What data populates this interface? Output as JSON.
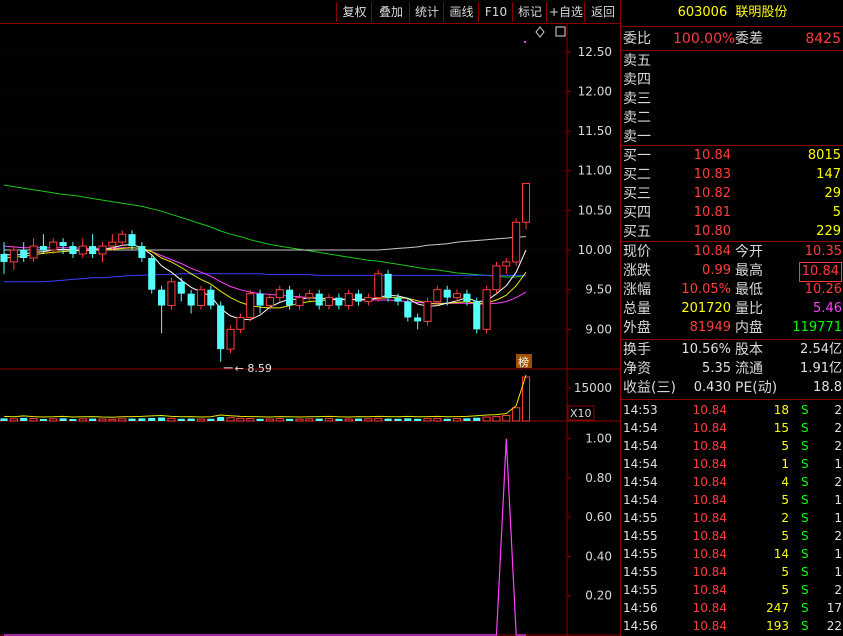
{
  "toolbar": [
    "复权",
    "叠加",
    "统计",
    "画线",
    "F10",
    "标记",
    "+自选",
    "返回"
  ],
  "stock": {
    "code": "603006",
    "name": "联明股份"
  },
  "price_axis": [
    "12.50",
    "12.00",
    "11.50",
    "11.00",
    "10.50",
    "10.00",
    "9.50",
    "9.00"
  ],
  "vol_axis": {
    "label": "15000",
    "mult": "X10"
  },
  "ind_axis": [
    "1.00",
    "0.80",
    "0.60",
    "0.40",
    "0.20"
  ],
  "low_marker": "8.59",
  "bang_label": "榜",
  "order_ratio": {
    "label1": "委比",
    "value1": "100.00%",
    "label2": "委差",
    "value2": "8425"
  },
  "sells": [
    {
      "label": "卖五"
    },
    {
      "label": "卖四"
    },
    {
      "label": "卖三"
    },
    {
      "label": "卖二"
    },
    {
      "label": "卖一"
    }
  ],
  "buys": [
    {
      "label": "买一",
      "price": "10.84",
      "vol": "8015"
    },
    {
      "label": "买二",
      "price": "10.83",
      "vol": "147"
    },
    {
      "label": "买三",
      "price": "10.82",
      "vol": "29"
    },
    {
      "label": "买四",
      "price": "10.81",
      "vol": "5"
    },
    {
      "label": "买五",
      "price": "10.80",
      "vol": "229"
    }
  ],
  "quote": [
    {
      "l1": "现价",
      "v1": "10.84",
      "c1": "red",
      "l2": "今开",
      "v2": "10.35",
      "c2": "red"
    },
    {
      "l1": "涨跌",
      "v1": "0.99",
      "c1": "red",
      "l2": "最高",
      "v2": "10.84",
      "c2": "red"
    },
    {
      "l1": "涨幅",
      "v1": "10.05%",
      "c1": "red",
      "l2": "最低",
      "v2": "10.26",
      "c2": "red"
    },
    {
      "l1": "总量",
      "v1": "201720",
      "c1": "yel",
      "l2": "量比",
      "v2": "5.46",
      "c2": "mag"
    },
    {
      "l1": "外盘",
      "v1": "81949",
      "c1": "red",
      "l2": "内盘",
      "v2": "119771",
      "c2": "grn"
    }
  ],
  "fund": [
    {
      "l1": "换手",
      "v1": "10.56%",
      "l2": "股本",
      "v2": "2.54亿"
    },
    {
      "l1": "净资",
      "v1": "5.35",
      "l2": "流通",
      "v2": "1.91亿"
    },
    {
      "l1": "收益(三)",
      "v1": "0.430",
      "l2": "PE(动)",
      "v2": "18.8"
    }
  ],
  "trades": [
    {
      "t": "14:53",
      "p": "10.84",
      "v": "18",
      "s": "S",
      "n": "2"
    },
    {
      "t": "14:54",
      "p": "10.84",
      "v": "15",
      "s": "S",
      "n": "2"
    },
    {
      "t": "14:54",
      "p": "10.84",
      "v": "5",
      "s": "S",
      "n": "2"
    },
    {
      "t": "14:54",
      "p": "10.84",
      "v": "1",
      "s": "S",
      "n": "1"
    },
    {
      "t": "14:54",
      "p": "10.84",
      "v": "4",
      "s": "S",
      "n": "2"
    },
    {
      "t": "14:54",
      "p": "10.84",
      "v": "5",
      "s": "S",
      "n": "1"
    },
    {
      "t": "14:55",
      "p": "10.84",
      "v": "2",
      "s": "S",
      "n": "1"
    },
    {
      "t": "14:55",
      "p": "10.84",
      "v": "5",
      "s": "S",
      "n": "2"
    },
    {
      "t": "14:55",
      "p": "10.84",
      "v": "14",
      "s": "S",
      "n": "1"
    },
    {
      "t": "14:55",
      "p": "10.84",
      "v": "5",
      "s": "S",
      "n": "1"
    },
    {
      "t": "14:55",
      "p": "10.84",
      "v": "5",
      "s": "S",
      "n": "2"
    },
    {
      "t": "14:56",
      "p": "10.84",
      "v": "247",
      "s": "S",
      "n": "17"
    },
    {
      "t": "14:56",
      "p": "10.84",
      "v": "193",
      "s": "S",
      "n": "22"
    }
  ],
  "chart_data": {
    "type": "candlestick",
    "price_range": [
      8.5,
      12.85
    ],
    "candles": [
      {
        "o": 9.95,
        "c": 9.85,
        "h": 10.1,
        "l": 9.7
      },
      {
        "o": 9.85,
        "c": 10.0,
        "h": 10.05,
        "l": 9.75
      },
      {
        "o": 10.0,
        "c": 9.9,
        "h": 10.1,
        "l": 9.85
      },
      {
        "o": 9.9,
        "c": 10.05,
        "h": 10.15,
        "l": 9.85
      },
      {
        "o": 10.05,
        "c": 10.0,
        "h": 10.2,
        "l": 9.95
      },
      {
        "o": 10.0,
        "c": 10.1,
        "h": 10.15,
        "l": 9.95
      },
      {
        "o": 10.1,
        "c": 10.05,
        "h": 10.15,
        "l": 9.95
      },
      {
        "o": 10.05,
        "c": 9.95,
        "h": 10.1,
        "l": 9.9
      },
      {
        "o": 9.95,
        "c": 10.05,
        "h": 10.15,
        "l": 9.9
      },
      {
        "o": 10.05,
        "c": 9.95,
        "h": 10.2,
        "l": 9.9
      },
      {
        "o": 9.95,
        "c": 10.05,
        "h": 10.1,
        "l": 9.85
      },
      {
        "o": 10.05,
        "c": 10.1,
        "h": 10.2,
        "l": 10.0
      },
      {
        "o": 10.1,
        "c": 10.2,
        "h": 10.25,
        "l": 10.05
      },
      {
        "o": 10.2,
        "c": 10.05,
        "h": 10.25,
        "l": 10.0
      },
      {
        "o": 10.05,
        "c": 9.9,
        "h": 10.1,
        "l": 9.85
      },
      {
        "o": 9.9,
        "c": 9.5,
        "h": 9.95,
        "l": 9.45
      },
      {
        "o": 9.5,
        "c": 9.3,
        "h": 9.55,
        "l": 8.95
      },
      {
        "o": 9.3,
        "c": 9.6,
        "h": 9.65,
        "l": 9.25
      },
      {
        "o": 9.6,
        "c": 9.45,
        "h": 9.65,
        "l": 9.35
      },
      {
        "o": 9.45,
        "c": 9.3,
        "h": 9.5,
        "l": 9.2
      },
      {
        "o": 9.3,
        "c": 9.5,
        "h": 9.55,
        "l": 9.25
      },
      {
        "o": 9.5,
        "c": 9.3,
        "h": 9.55,
        "l": 9.25
      },
      {
        "o": 9.3,
        "c": 8.75,
        "h": 9.35,
        "l": 8.59
      },
      {
        "o": 8.75,
        "c": 9.0,
        "h": 9.05,
        "l": 8.7
      },
      {
        "o": 9.0,
        "c": 9.15,
        "h": 9.2,
        "l": 8.95
      },
      {
        "o": 9.15,
        "c": 9.45,
        "h": 9.5,
        "l": 9.1
      },
      {
        "o": 9.45,
        "c": 9.3,
        "h": 9.5,
        "l": 9.2
      },
      {
        "o": 9.3,
        "c": 9.4,
        "h": 9.45,
        "l": 9.25
      },
      {
        "o": 9.4,
        "c": 9.5,
        "h": 9.55,
        "l": 9.35
      },
      {
        "o": 9.5,
        "c": 9.3,
        "h": 9.55,
        "l": 9.25
      },
      {
        "o": 9.3,
        "c": 9.4,
        "h": 9.45,
        "l": 9.25
      },
      {
        "o": 9.4,
        "c": 9.45,
        "h": 9.5,
        "l": 9.35
      },
      {
        "o": 9.45,
        "c": 9.3,
        "h": 9.5,
        "l": 9.25
      },
      {
        "o": 9.3,
        "c": 9.4,
        "h": 9.45,
        "l": 9.25
      },
      {
        "o": 9.4,
        "c": 9.3,
        "h": 9.45,
        "l": 9.25
      },
      {
        "o": 9.3,
        "c": 9.45,
        "h": 9.5,
        "l": 9.25
      },
      {
        "o": 9.45,
        "c": 9.35,
        "h": 9.5,
        "l": 9.3
      },
      {
        "o": 9.35,
        "c": 9.4,
        "h": 9.45,
        "l": 9.3
      },
      {
        "o": 9.4,
        "c": 9.7,
        "h": 9.75,
        "l": 9.35
      },
      {
        "o": 9.7,
        "c": 9.4,
        "h": 9.75,
        "l": 9.35
      },
      {
        "o": 9.4,
        "c": 9.35,
        "h": 9.45,
        "l": 9.3
      },
      {
        "o": 9.35,
        "c": 9.15,
        "h": 9.4,
        "l": 9.1
      },
      {
        "o": 9.15,
        "c": 9.1,
        "h": 9.2,
        "l": 9.0
      },
      {
        "o": 9.1,
        "c": 9.35,
        "h": 9.4,
        "l": 9.05
      },
      {
        "o": 9.35,
        "c": 9.5,
        "h": 9.55,
        "l": 9.3
      },
      {
        "o": 9.5,
        "c": 9.4,
        "h": 9.55,
        "l": 9.3
      },
      {
        "o": 9.4,
        "c": 9.45,
        "h": 9.5,
        "l": 9.35
      },
      {
        "o": 9.45,
        "c": 9.35,
        "h": 9.5,
        "l": 9.3
      },
      {
        "o": 9.35,
        "c": 9.0,
        "h": 9.4,
        "l": 8.95
      },
      {
        "o": 9.0,
        "c": 9.5,
        "h": 9.55,
        "l": 8.95
      },
      {
        "o": 9.5,
        "c": 9.8,
        "h": 9.85,
        "l": 9.45
      },
      {
        "o": 9.8,
        "c": 9.85,
        "h": 9.9,
        "l": 9.7
      },
      {
        "o": 9.85,
        "c": 10.35,
        "h": 10.4,
        "l": 9.8
      },
      {
        "o": 10.35,
        "c": 10.84,
        "h": 10.84,
        "l": 10.26
      }
    ],
    "ma_white": [
      9.95,
      9.93,
      9.95,
      9.97,
      9.98,
      10.0,
      10.01,
      10.0,
      10.0,
      10.0,
      10.01,
      10.03,
      10.06,
      10.07,
      10.03,
      9.94,
      9.8,
      9.72,
      9.62,
      9.53,
      9.47,
      9.42,
      9.26,
      9.17,
      9.13,
      9.12,
      9.18,
      9.28,
      9.34,
      9.38,
      9.38,
      9.4,
      9.39,
      9.38,
      9.38,
      9.37,
      9.38,
      9.37,
      9.4,
      9.43,
      9.42,
      9.39,
      9.32,
      9.29,
      9.3,
      9.33,
      9.36,
      9.4,
      9.35,
      9.36,
      9.45,
      9.55,
      9.72,
      10.0
    ],
    "ma_yellow": [
      9.9,
      9.91,
      9.92,
      9.94,
      9.96,
      9.97,
      9.98,
      9.99,
      9.99,
      10.0,
      10.0,
      10.01,
      10.02,
      10.03,
      10.02,
      9.98,
      9.9,
      9.85,
      9.78,
      9.7,
      9.63,
      9.57,
      9.48,
      9.4,
      9.34,
      9.3,
      9.28,
      9.27,
      9.27,
      9.3,
      9.33,
      9.35,
      9.36,
      9.37,
      9.38,
      9.38,
      9.38,
      9.38,
      9.39,
      9.4,
      9.4,
      9.39,
      9.36,
      9.33,
      9.32,
      9.33,
      9.34,
      9.35,
      9.33,
      9.33,
      9.37,
      9.43,
      9.55,
      9.72
    ],
    "ma_magenta": [
      10.05,
      10.04,
      10.03,
      10.03,
      10.03,
      10.03,
      10.03,
      10.03,
      10.02,
      10.02,
      10.02,
      10.02,
      10.03,
      10.03,
      10.02,
      9.98,
      9.93,
      9.88,
      9.83,
      9.77,
      9.72,
      9.67,
      9.6,
      9.54,
      9.5,
      9.47,
      9.45,
      9.44,
      9.43,
      9.42,
      9.41,
      9.4,
      9.39,
      9.39,
      9.38,
      9.38,
      9.37,
      9.37,
      9.37,
      9.37,
      9.36,
      9.35,
      9.34,
      9.33,
      9.33,
      9.33,
      9.33,
      9.33,
      9.32,
      9.32,
      9.33,
      9.35,
      9.4,
      9.47
    ],
    "ma_green": [
      10.82,
      10.8,
      10.78,
      10.76,
      10.74,
      10.72,
      10.7,
      10.69,
      10.67,
      10.65,
      10.63,
      10.61,
      10.59,
      10.57,
      10.55,
      10.52,
      10.49,
      10.45,
      10.41,
      10.37,
      10.33,
      10.29,
      10.24,
      10.2,
      10.17,
      10.13,
      10.1,
      10.07,
      10.05,
      10.03,
      10.01,
      9.99,
      9.97,
      9.95,
      9.93,
      9.91,
      9.89,
      9.87,
      9.86,
      9.84,
      9.82,
      9.8,
      9.78,
      9.76,
      9.75,
      9.73,
      9.71,
      9.7,
      9.69,
      9.68,
      9.67,
      9.66,
      9.66,
      9.68
    ],
    "ma_blue": [
      9.6,
      9.6,
      9.6,
      9.6,
      9.6,
      9.61,
      9.62,
      9.63,
      9.64,
      9.65,
      9.65,
      9.66,
      9.67,
      9.68,
      9.68,
      9.69,
      9.69,
      9.69,
      9.7,
      9.7,
      9.7,
      9.7,
      9.7,
      9.7,
      9.7,
      9.7,
      9.7,
      9.69,
      9.69,
      9.69,
      9.69,
      9.69,
      9.68,
      9.68,
      9.68,
      9.68,
      9.68,
      9.68,
      9.68,
      9.68,
      9.68,
      9.68,
      9.68,
      9.68,
      9.68,
      9.68,
      9.68,
      9.68,
      9.68,
      9.68,
      9.68,
      9.68,
      9.68,
      9.68
    ],
    "ma_grey": [
      10.0,
      10.0,
      10.0,
      10.0,
      10.0,
      10.0,
      10.0,
      10.0,
      10.0,
      10.0,
      10.0,
      10.0,
      10.0,
      10.0,
      10.0,
      10.0,
      10.0,
      10.0,
      10.0,
      10.0,
      10.0,
      10.0,
      10.0,
      10.0,
      10.0,
      10.0,
      10.0,
      10.0,
      10.0,
      10.0,
      10.0,
      10.0,
      10.0,
      10.0,
      10.0,
      10.0,
      10.0,
      10.0,
      10.0,
      10.01,
      10.02,
      10.03,
      10.04,
      10.06,
      10.07,
      10.08,
      10.1,
      10.11,
      10.12,
      10.13,
      10.14,
      10.15,
      10.16,
      10.17
    ],
    "volumes": [
      12,
      10,
      14,
      11,
      9,
      10,
      12,
      9,
      10,
      11,
      9,
      8,
      10,
      11,
      12,
      14,
      16,
      12,
      10,
      11,
      9,
      10,
      18,
      15,
      12,
      11,
      10,
      9,
      11,
      10,
      9,
      10,
      11,
      12,
      10,
      9,
      11,
      10,
      12,
      11,
      10,
      12,
      10,
      11,
      12,
      10,
      11,
      12,
      15,
      18,
      20,
      25,
      60,
      200
    ],
    "vol_range": [
      0,
      200
    ],
    "indicator": [
      0,
      0,
      0,
      0,
      0,
      0,
      0,
      0,
      0,
      0,
      0,
      0,
      0,
      0,
      0,
      0,
      0,
      0,
      0,
      0,
      0,
      0,
      0,
      0,
      0,
      0,
      0,
      0,
      0,
      0,
      0,
      0,
      0,
      0,
      0,
      0,
      0,
      0,
      0,
      0,
      0,
      0,
      0,
      0,
      0,
      0,
      0,
      0,
      0,
      0,
      0,
      1.0,
      0,
      0
    ],
    "ind_range": [
      0,
      1.08
    ]
  }
}
